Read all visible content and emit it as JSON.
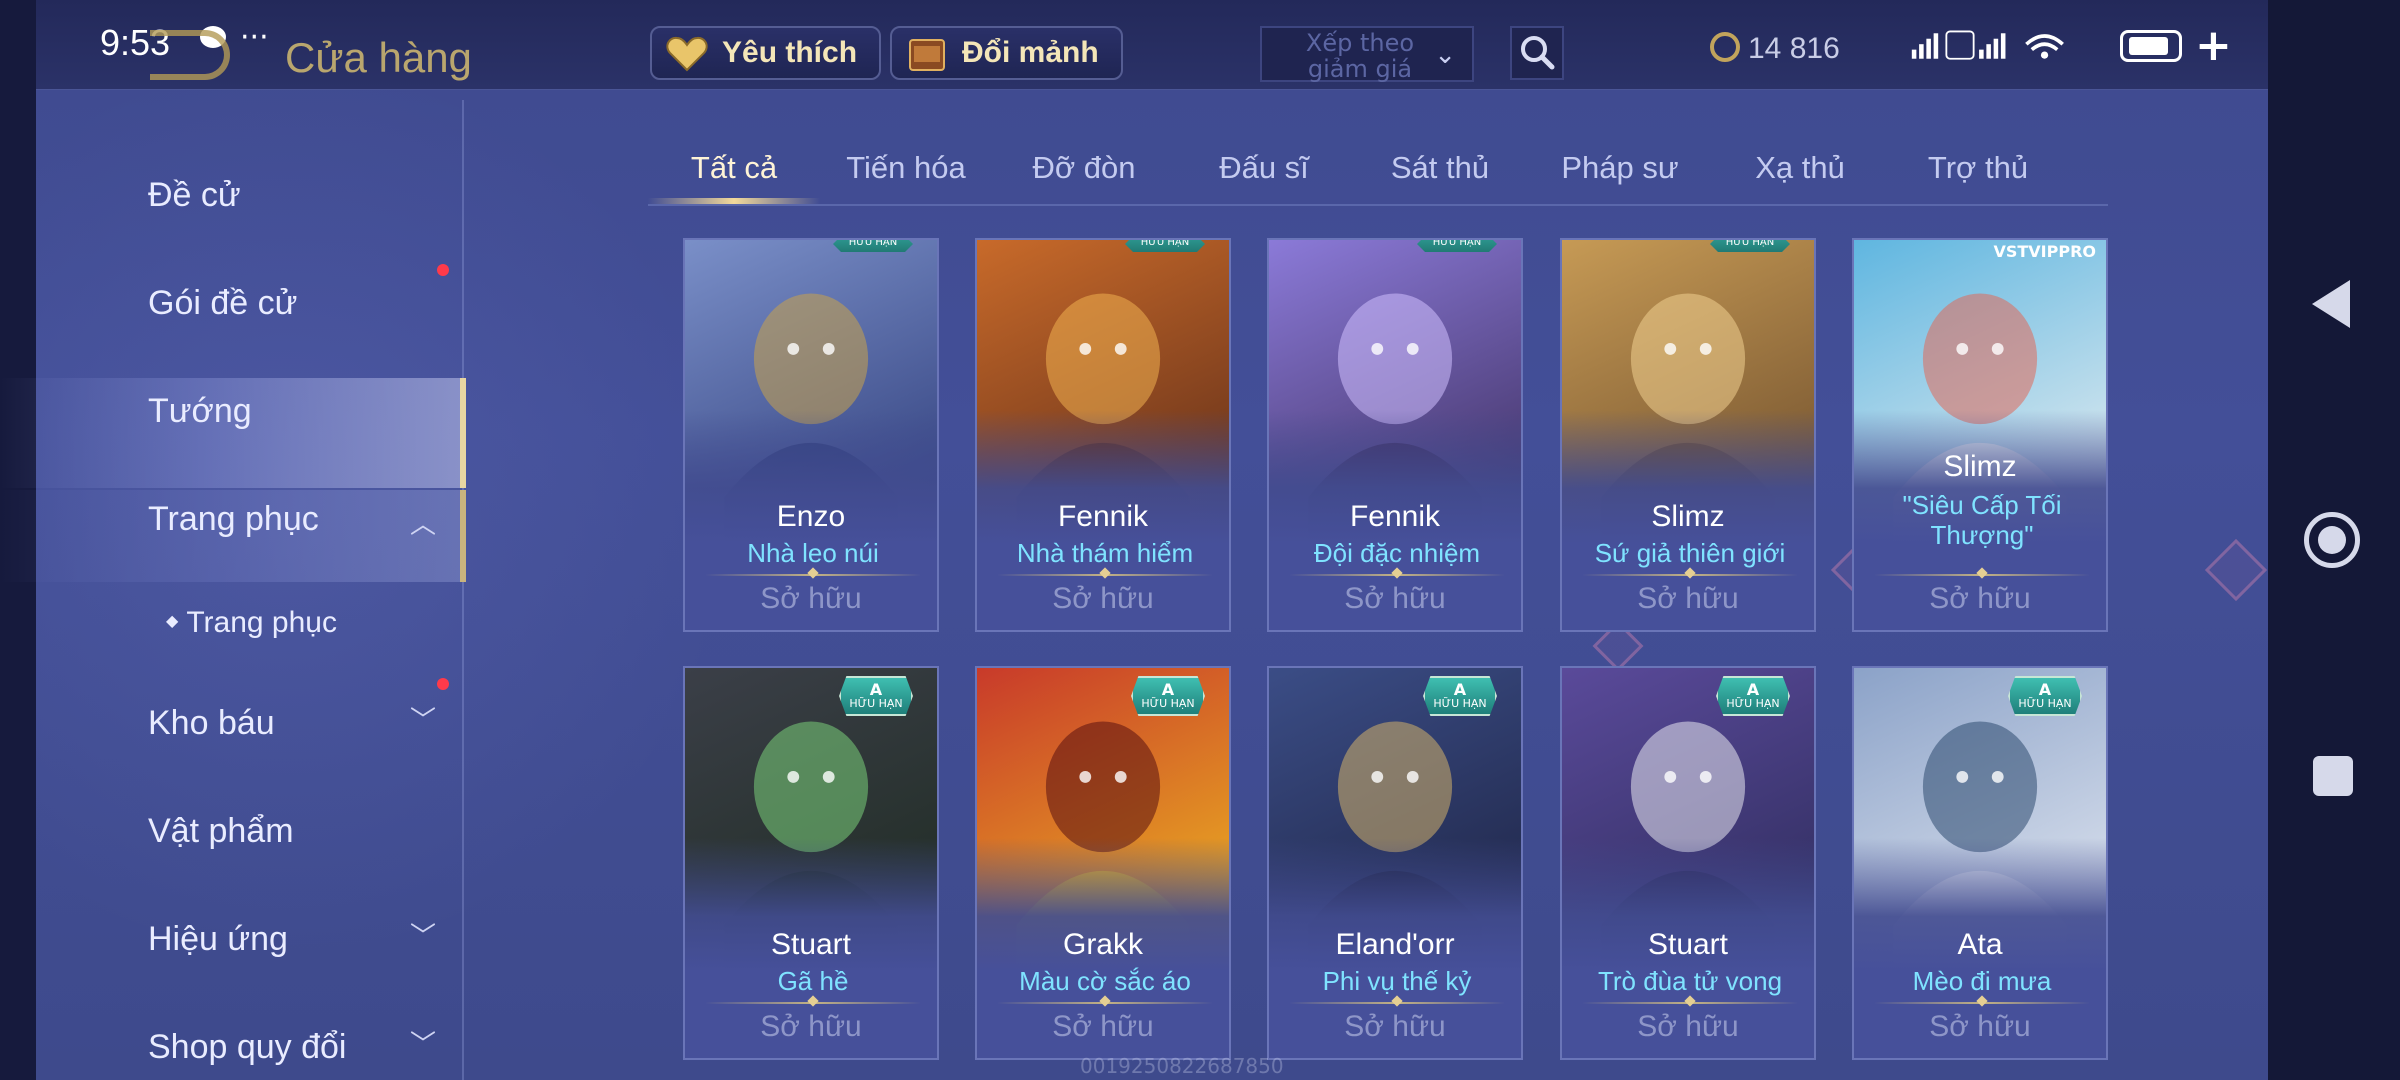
{
  "status_bar": {
    "time": "9:53",
    "dots": "···",
    "battery": "84",
    "battery_level": 0.84
  },
  "header": {
    "title": "Cửa hàng",
    "favorite_label": "Yêu thích",
    "shard_label": "Đổi mảnh",
    "sort_label": "Xếp theo giảm giá",
    "coins": "14 816",
    "plus": "+"
  },
  "sidebar": {
    "items": [
      {
        "label": "Đề cử"
      },
      {
        "label": "Gói đề cử"
      },
      {
        "label": "Tướng"
      },
      {
        "label": "Trang phục"
      },
      {
        "label": "Trang phục"
      },
      {
        "label": "Kho báu"
      },
      {
        "label": "Vật phẩm"
      },
      {
        "label": "Hiệu ứng"
      },
      {
        "label": "Shop quy đổi"
      }
    ]
  },
  "tabs": [
    "Tất cả",
    "Tiến hóa",
    "Đỡ đòn",
    "Đấu sĩ",
    "Sát thủ",
    "Pháp sư",
    "Xạ thủ",
    "Trợ thủ"
  ],
  "badge": {
    "grade": "A",
    "text": "HỮU HẠN"
  },
  "watermark_tag": "VSTVIPPRO",
  "cards": [
    {
      "hero": "Enzo",
      "skin": "Nhà leo núi",
      "status": "Sở hữu",
      "colors": [
        "#7a8fc8",
        "#2c3a78",
        "#c9a24a"
      ]
    },
    {
      "hero": "Fennik",
      "skin": "Nhà thám hiểm",
      "status": "Sở hữu",
      "colors": [
        "#c86a2a",
        "#5a2a18",
        "#f0b050"
      ]
    },
    {
      "hero": "Fennik",
      "skin": "Đội đặc nhiệm",
      "status": "Sở hữu",
      "colors": [
        "#8b7ad8",
        "#3a2b5a",
        "#d0c0ff"
      ]
    },
    {
      "hero": "Slimz",
      "skin": "Sứ giả thiên giới",
      "status": "Sở hữu",
      "colors": [
        "#c69a55",
        "#6a4a2a",
        "#f0d090"
      ]
    },
    {
      "hero": "Slimz",
      "skin": "\"Siêu Cấp Tối Thượng\"",
      "status": "Sở hữu",
      "colors": [
        "#5fb6e0",
        "#f2f2f2",
        "#e06a5a"
      ]
    },
    {
      "hero": "Stuart",
      "skin": "Gã hề",
      "status": "Sở hữu",
      "colors": [
        "#3b3f48",
        "#1d2a20",
        "#7ad07a"
      ]
    },
    {
      "hero": "Grakk",
      "skin": "Màu cờ sắc áo",
      "status": "Sở hữu",
      "colors": [
        "#c83a2a",
        "#f0c020",
        "#5a1010"
      ]
    },
    {
      "hero": "Eland'orr",
      "skin": "Phi vụ thế kỷ",
      "status": "Sở hữu",
      "colors": [
        "#3b4d86",
        "#1c2140",
        "#d2b06a"
      ]
    },
    {
      "hero": "Stuart",
      "skin": "Trò đùa tử vong",
      "status": "Sở hữu",
      "colors": [
        "#5a4a9a",
        "#2b2a58",
        "#e8e8f0"
      ]
    },
    {
      "hero": "Ata",
      "skin": "Mèo đi mưa",
      "status": "Sở hữu",
      "colors": [
        "#8ba2c8",
        "#e8ecf4",
        "#2d4a70"
      ]
    }
  ],
  "watermark": "0019250822687850"
}
